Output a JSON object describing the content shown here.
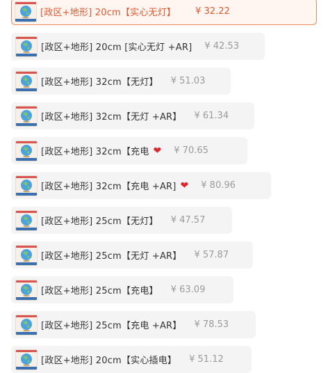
{
  "colors": {
    "selected_accent": "#e8562a",
    "selected_border": "#f08a5d",
    "option_bg": "#f4f4f4",
    "heart": "#e0242b"
  },
  "options": [
    {
      "label": "[政区+地形] 20cm【实心无灯】",
      "price": "¥ 32.22",
      "selected": true,
      "heart": false,
      "thumb": "globe-thumbnail"
    },
    {
      "label": "[政区+地形] 20cm [实心无灯 +AR]",
      "price": "¥ 42.53",
      "selected": false,
      "heart": false,
      "thumb": "globe-thumbnail"
    },
    {
      "label": "[政区+地形] 32cm【无灯】",
      "price": "¥ 51.03",
      "selected": false,
      "heart": false,
      "thumb": "globe-thumbnail"
    },
    {
      "label": "[政区+地形] 32cm【无灯 +AR】",
      "price": "¥ 61.34",
      "selected": false,
      "heart": false,
      "thumb": "globe-thumbnail"
    },
    {
      "label": "[政区+地形] 32cm【充电",
      "price": "¥ 70.65",
      "selected": false,
      "heart": true,
      "thumb": "globe-thumbnail"
    },
    {
      "label": "[政区+地形] 32cm【充电 +AR]",
      "price": "¥ 80.96",
      "selected": false,
      "heart": true,
      "thumb": "globe-thumbnail"
    },
    {
      "label": "[政区+地形] 25cm【无灯】",
      "price": "¥ 47.57",
      "selected": false,
      "heart": false,
      "thumb": "globe-thumbnail"
    },
    {
      "label": "[政区+地形] 25cm【无灯 +AR】",
      "price": "¥ 57.87",
      "selected": false,
      "heart": false,
      "thumb": "globe-thumbnail"
    },
    {
      "label": "[政区+地形] 25cm【充电】",
      "price": "¥ 63.09",
      "selected": false,
      "heart": false,
      "thumb": "globe-thumbnail"
    },
    {
      "label": "[政区+地形] 25cm【充电 +AR】",
      "price": "¥ 78.53",
      "selected": false,
      "heart": false,
      "thumb": "globe-thumbnail"
    },
    {
      "label": "[政区+地形] 20cm【实心插电】",
      "price": "¥ 51.12",
      "selected": false,
      "heart": false,
      "thumb": "globe-thumbnail"
    }
  ]
}
